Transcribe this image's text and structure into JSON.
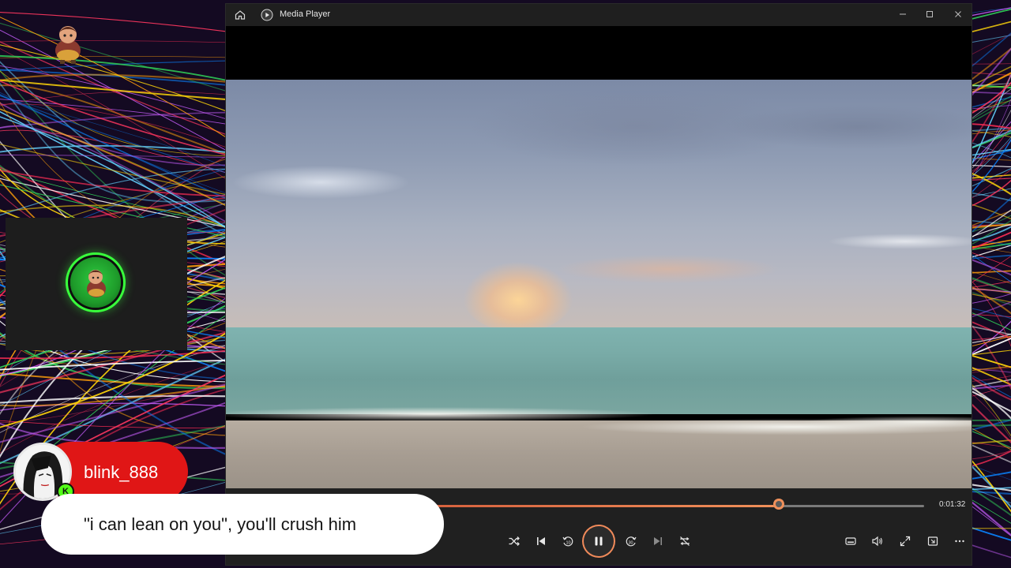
{
  "window": {
    "title": "Media Player",
    "time_elapsed": "0:01:32",
    "progress": 0.79
  },
  "controls": {
    "left_labels": [
      "shuffle",
      "previous",
      "rewind-10",
      "play-pause",
      "forward-30",
      "next",
      "repeat"
    ],
    "rewind_label": "10",
    "forward_label": "30"
  },
  "chat": {
    "username": "blink_888",
    "badge": "K",
    "message": "\"i can lean on you\", you'll crush him"
  },
  "colors": {
    "accent": "#f0905a",
    "chat_pill": "#e01616",
    "badge": "#53fc18",
    "cam_ring": "#39ff3c"
  }
}
